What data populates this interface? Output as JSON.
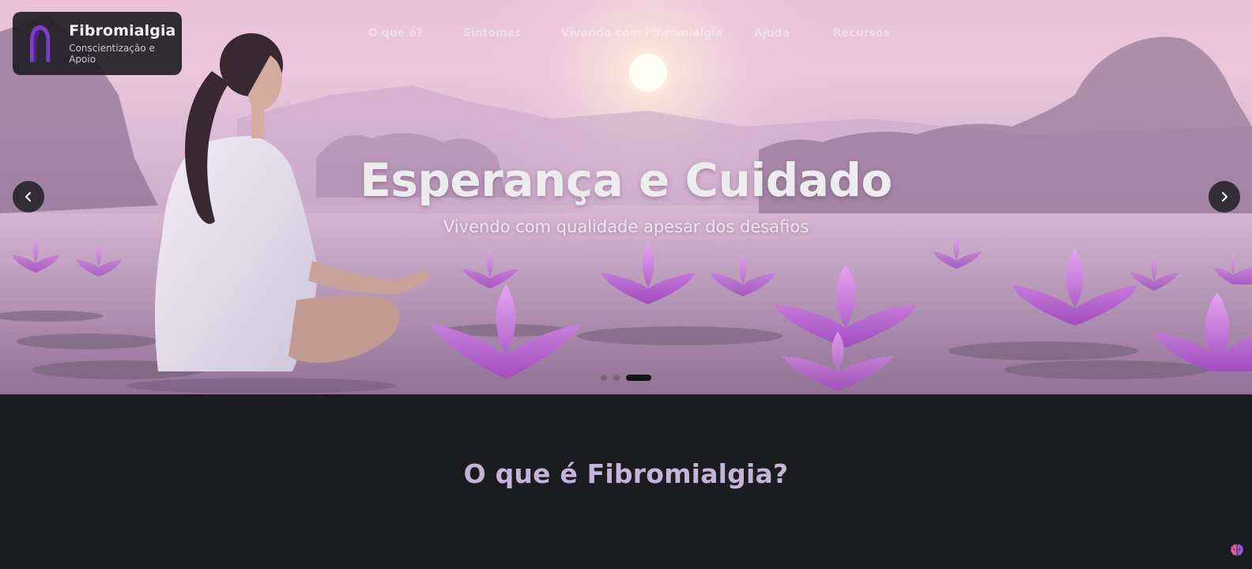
{
  "brand": {
    "name": "Fibromialgia",
    "tagline": "Conscientização e Apoio",
    "logo_icon": "ribbon-icon",
    "accent": "#7b3fc4"
  },
  "nav": {
    "items": [
      {
        "label": "O que é?"
      },
      {
        "label": "Sintomas"
      },
      {
        "label": "Vivendo com Fibromialgia"
      },
      {
        "label": "Ajuda"
      },
      {
        "label": "Recursos"
      }
    ]
  },
  "carousel": {
    "title": "Esperança e Cuidado",
    "subtitle": "Vivendo com qualidade apesar dos desafios",
    "prev_icon": "chevron-left-icon",
    "next_icon": "chevron-right-icon",
    "slide_count": 3,
    "active_index": 2
  },
  "main": {
    "section_title": "O que é Fibromialgia?"
  },
  "floating": {
    "icon": "brain-icon"
  }
}
